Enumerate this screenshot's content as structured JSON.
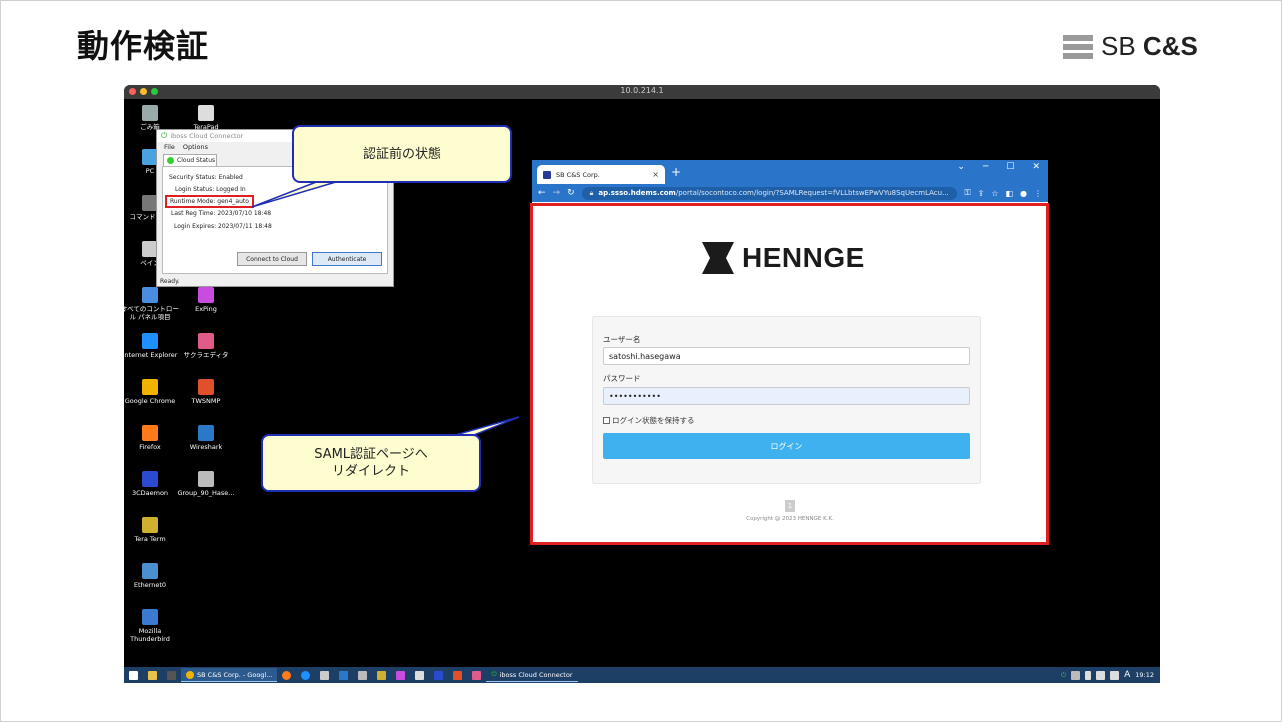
{
  "slide": {
    "title": "動作検証"
  },
  "logo": {
    "bars": 3,
    "text_sb": "SB ",
    "text_cs": "C&S"
  },
  "mac_window": {
    "title": "10.0.214.1",
    "dot_colors": [
      "#ff5f57",
      "#febc2e",
      "#28c840"
    ]
  },
  "desktop_icons": [
    {
      "label": "ごみ箱",
      "icon": "recycle-bin-icon",
      "color": "#9aa"
    },
    {
      "label": "TeraPad",
      "icon": "terapad-icon",
      "color": "#ddd"
    },
    {
      "label": "PC",
      "icon": "pc-icon",
      "color": "#4aa3e0"
    },
    {
      "label": "コマンド プロ",
      "icon": "cmd-icon",
      "color": "#777"
    },
    {
      "label": "ペイン",
      "icon": "paint-icon",
      "color": "#ccc"
    },
    {
      "label": "すべてのコントロール パネル項目",
      "icon": "control-panel-icon",
      "color": "#4a8ce0"
    },
    {
      "label": "ExPing",
      "icon": "exping-icon",
      "color": "#c84ce0"
    },
    {
      "label": "Internet Explorer",
      "icon": "ie-icon",
      "color": "#1e90ff"
    },
    {
      "label": "サクラエディタ",
      "icon": "sakura-editor-icon",
      "color": "#e05a8a"
    },
    {
      "label": "Google Chrome",
      "icon": "chrome-icon",
      "color": "#f0b400"
    },
    {
      "label": "TWSNMP",
      "icon": "twsnmp-icon",
      "color": "#e0502a"
    },
    {
      "label": "Firefox",
      "icon": "firefox-icon",
      "color": "#ff7a1a"
    },
    {
      "label": "Wireshark",
      "icon": "wireshark-icon",
      "color": "#2a78c8"
    },
    {
      "label": "3CDaemon",
      "icon": "3cdaemon-icon",
      "color": "#2a4ad0"
    },
    {
      "label": "Group_90_Hase...",
      "icon": "file-icon",
      "color": "#bbb"
    },
    {
      "label": "Tera Term",
      "icon": "teraterm-icon",
      "color": "#d0b030"
    },
    {
      "label": "Ethernet0",
      "icon": "network-icon",
      "color": "#4a90d0"
    },
    {
      "label": "Mozilla Thunderbird",
      "icon": "thunderbird-icon",
      "color": "#3a7ad0"
    }
  ],
  "iboss": {
    "title": "iboss Cloud Connector",
    "menu": [
      "File",
      "Options"
    ],
    "tab": "Cloud Status",
    "rows": [
      {
        "label": "Security Status:",
        "value": "Enabled"
      },
      {
        "label": "Login Status:",
        "value": "Logged In"
      },
      {
        "label": "Runtime Mode:",
        "value": "gen4_auto"
      },
      {
        "label": "Last Reg Time:",
        "value": "2023/07/10 18:48"
      },
      {
        "label": "Login Expires:",
        "value": "2023/07/11 18:48"
      }
    ],
    "buttons": {
      "connect": "Connect to Cloud",
      "authenticate": "Authenticate"
    },
    "status": "Ready."
  },
  "browser": {
    "tab_title": "SB C&S Corp.",
    "tab_close": "×",
    "new_tab": "+",
    "window_controls": [
      "⌄",
      "─",
      "☐",
      "✕"
    ],
    "url_host": "ap.ssso.hdems.com",
    "url_rest": "/portal/socontoco.com/login/?SAMLRequest=fVLLbtswEPwVYu8SqUecmLAcu..."
  },
  "login_page": {
    "brand": "HENNGE",
    "username_label": "ユーザー名",
    "username_value": "satoshi.hasegawa",
    "password_label": "パスワード",
    "password_value": "•••••••••••",
    "remember_label": "ログイン状態を保持する",
    "login_button": "ログイン",
    "footer_badge": "1",
    "copyright": "Copyright @ 2023 HENNGE K.K."
  },
  "callouts": {
    "before_auth": "認証前の状態",
    "saml_line1": "SAML認証ページへ",
    "saml_line2": "リダイレクト"
  },
  "taskbar": {
    "chrome_app": "SB C&S Corp. - Googl...",
    "iboss_app": "iboss Cloud Connector",
    "ime": "A",
    "clock": "19:12"
  }
}
